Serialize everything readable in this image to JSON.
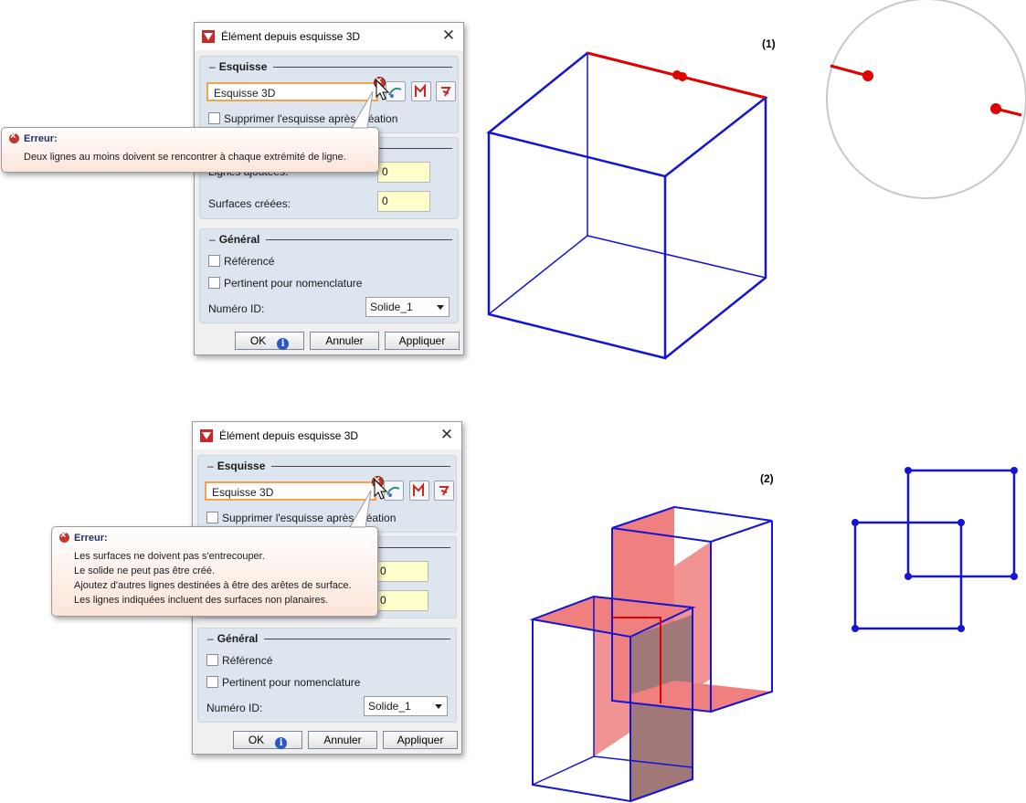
{
  "dialogs": [
    {
      "title": "Élément depuis esquisse 3D",
      "section_sketch": "Esquisse",
      "sketch_value": "Esquisse 3D",
      "delete_checkbox": "Supprimer l'esquisse après création",
      "lines_label": "Lignes ajoutées:",
      "lines_value": "0",
      "surfaces_label": "Surfaces créées:",
      "surfaces_value": "0",
      "section_general": "Général",
      "referenced": "Référencé",
      "relevant_bom": "Pertinent pour nomenclature",
      "id_label": "Numéro ID:",
      "id_value": "Solide_1",
      "ok": "OK",
      "cancel": "Annuler",
      "apply": "Appliquer",
      "error_title": "Erreur:",
      "error_lines": [
        "Deux lignes au moins doivent se rencontrer à chaque extrémité de ligne."
      ]
    },
    {
      "title": "Élément depuis esquisse 3D",
      "section_sketch": "Esquisse",
      "sketch_value": "Esquisse 3D",
      "delete_checkbox": "Supprimer l'esquisse après création",
      "lines_value": "0",
      "surfaces_value": "0",
      "section_general": "Général",
      "referenced": "Référencé",
      "relevant_bom": "Pertinent pour nomenclature",
      "id_label": "Numéro ID:",
      "id_value": "Solide_1",
      "ok": "OK",
      "cancel": "Annuler",
      "apply": "Appliquer",
      "error_title": "Erreur:",
      "error_lines": [
        "Les surfaces ne doivent pas s'entrecouper.",
        "Le solide ne peut pas être créé.",
        "Ajoutez d'autres lignes destinées à être des arêtes de surface.",
        "Les lignes indiquées incluent des surfaces non planaires."
      ]
    }
  ],
  "labels": {
    "one": "(1)",
    "two": "(2)"
  },
  "colors": {
    "edge_blue": "#1414d2",
    "edge_red": "#e00000",
    "face_red": "#f08080",
    "face_dark": "#a07878",
    "error_red": "#c0392b"
  },
  "icons": [
    "app-icon",
    "close-icon",
    "error-icon",
    "info-icon",
    "pick-sketch-icon",
    "sketch-tool-icon",
    "text-tool-icon",
    "dropdown-arrow-icon"
  ]
}
